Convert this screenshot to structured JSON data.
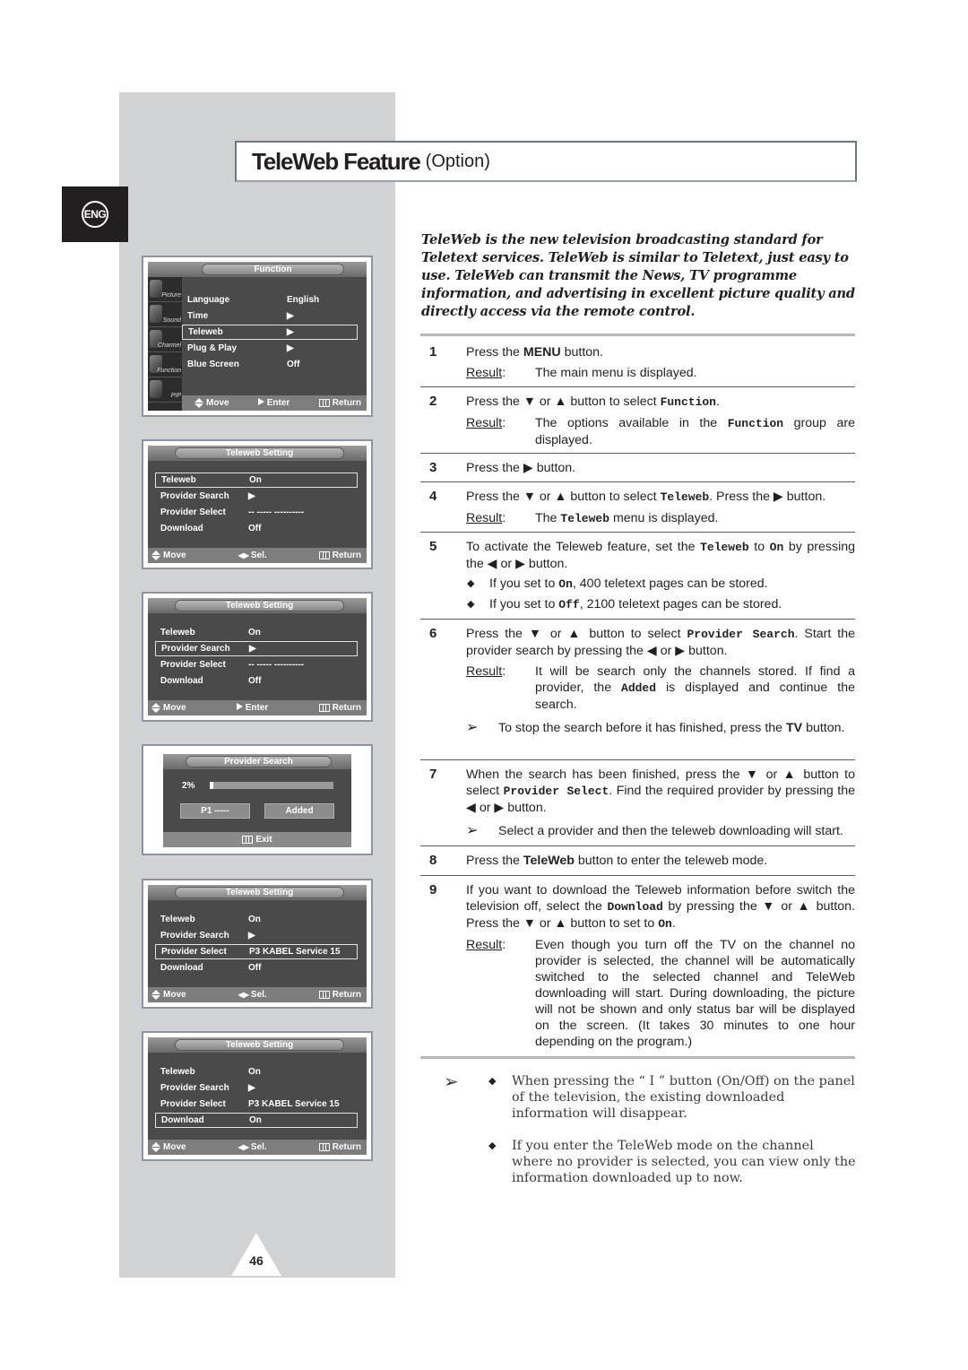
{
  "page": {
    "language_badge": "ENG",
    "title_main": "TeleWeb Feature",
    "title_sub": "(Option)",
    "page_number": "46"
  },
  "intro": "TeleWeb is the new television broadcasting standard for Teletext services. TeleWeb is similar to Teletext, just easy to use. TeleWeb can transmit the News, TV programme information, and advertising in excellent picture quality and directly access via the remote control.",
  "osd_common": {
    "move": "Move",
    "enter": "Enter",
    "sel": "Sel.",
    "return": "Return",
    "exit": "Exit"
  },
  "function_menu": {
    "title": "Function",
    "side_items": [
      "Picture",
      "Sound",
      "Channel",
      "Function",
      "PIP"
    ],
    "rows": [
      {
        "label": "Language",
        "value": "English"
      },
      {
        "label": "Time",
        "value": "▶"
      },
      {
        "label": "Teleweb",
        "value": "▶"
      },
      {
        "label": "Plug & Play",
        "value": "▶"
      },
      {
        "label": "Blue Screen",
        "value": "Off"
      }
    ],
    "selected_index": 2
  },
  "teleweb_screens": [
    {
      "title": "Teleweb Setting",
      "rows": [
        {
          "label": "Teleweb",
          "value": "On"
        },
        {
          "label": "Provider Search",
          "value": "▶"
        },
        {
          "label": "Provider Select",
          "value": "-- ----- ----------"
        },
        {
          "label": "Download",
          "value": "Off"
        }
      ],
      "selected_index": 0,
      "footer_mid": "Sel."
    },
    {
      "title": "Teleweb Setting",
      "rows": [
        {
          "label": "Teleweb",
          "value": "On"
        },
        {
          "label": "Provider Search",
          "value": "▶"
        },
        {
          "label": "Provider Select",
          "value": "-- ----- ----------"
        },
        {
          "label": "Download",
          "value": "Off"
        }
      ],
      "selected_index": 1,
      "footer_mid": "Enter"
    },
    {
      "title": "Teleweb Setting",
      "rows": [
        {
          "label": "Teleweb",
          "value": "On"
        },
        {
          "label": "Provider Search",
          "value": "▶"
        },
        {
          "label": "Provider Select",
          "value": "P3 KABEL Service 15"
        },
        {
          "label": "Download",
          "value": "Off"
        }
      ],
      "selected_index": 2,
      "footer_mid": "Sel."
    },
    {
      "title": "Teleweb Setting",
      "rows": [
        {
          "label": "Teleweb",
          "value": "On"
        },
        {
          "label": "Provider Search",
          "value": "▶"
        },
        {
          "label": "Provider Select",
          "value": "P3 KABEL Service 15"
        },
        {
          "label": "Download",
          "value": "On"
        }
      ],
      "selected_index": 3,
      "footer_mid": "Sel."
    }
  ],
  "provider_search": {
    "title": "Provider Search",
    "percent_label": "2%",
    "progress": 0.02,
    "provider_box": "P1 -----",
    "status_box": "Added"
  },
  "steps": {
    "result_label": "Result",
    "s1": {
      "num": "1",
      "a": "Press the ",
      "b": "MENU",
      "c": " button.",
      "result": "The main menu is displayed."
    },
    "s2": {
      "num": "2",
      "a": "Press the ▼ or ▲ button to select ",
      "m": "Function",
      "c": ".",
      "r1": "The options available in the ",
      "rm": "Function",
      "r2": " group are displayed."
    },
    "s3": {
      "num": "3",
      "a": "Press the ▶ button."
    },
    "s4": {
      "num": "4",
      "a": "Press the ▼ or ▲ button to select ",
      "m": "Teleweb",
      "c": ". Press the ▶ button.",
      "r1": "The ",
      "rm": "Teleweb",
      "r2": " menu is displayed."
    },
    "s5": {
      "num": "5",
      "a": "To activate the Teleweb feature, set the ",
      "m1": "Teleweb",
      "b": " to ",
      "m2": "On",
      "c": " by pressing the ◀ or ▶ button.",
      "bullet1_a": "If you set to ",
      "bullet1_m": "On",
      "bullet1_b": ", 400 teletext pages can be stored.",
      "bullet2_a": "If you set to ",
      "bullet2_m": "Off",
      "bullet2_b": ", 2100 teletext pages can be stored."
    },
    "s6": {
      "num": "6",
      "a": "Press the ▼ or ▲ button to select ",
      "m": "Provider Search",
      "c": ". Start the provider search by pressing the ◀ or ▶ button.",
      "r1": "It will be search only the channels stored. If find a provider, the ",
      "rm": "Added",
      "r2": " is displayed and continue the search.",
      "note_a": "To stop the search before it has finished, press the ",
      "note_b": "TV",
      "note_c": " button."
    },
    "s7": {
      "num": "7",
      "a": "When the search has been finished, press the ▼ or ▲ button to select ",
      "m": "Provider Select",
      "c": ". Find the required provider by pressing the ◀ or ▶ button.",
      "note": "Select a provider and then the teleweb downloading will start."
    },
    "s8": {
      "num": "8",
      "a": "Press the ",
      "b": "TeleWeb",
      "c": " button to enter the teleweb mode."
    },
    "s9": {
      "num": "9",
      "a": "If you want to download the Teleweb information before switch the television off, select the ",
      "m": "Download",
      "b": " by pressing the ▼ or ▲ button. Press the ▼ or ▲ button to set to ",
      "m2": "On",
      "c": ".",
      "result": "Even though you turn off the TV on the channel no provider is selected, the channel will be automatically switched to the selected channel and TeleWeb downloading will start. During downloading, the picture will not be shown and only status bar will be displayed on the screen. (It takes 30 minutes to one hour depending on the program.)"
    }
  },
  "final_notes": [
    "When pressing the “ I ” button (On/Off) on the panel of the television, the existing downloaded information will disappear.",
    "If you enter the TeleWeb mode on the channel where no provider is selected, you can view only the information downloaded up to now."
  ],
  "symbols": {
    "arrow_note": "➢",
    "diamond": "◆"
  }
}
